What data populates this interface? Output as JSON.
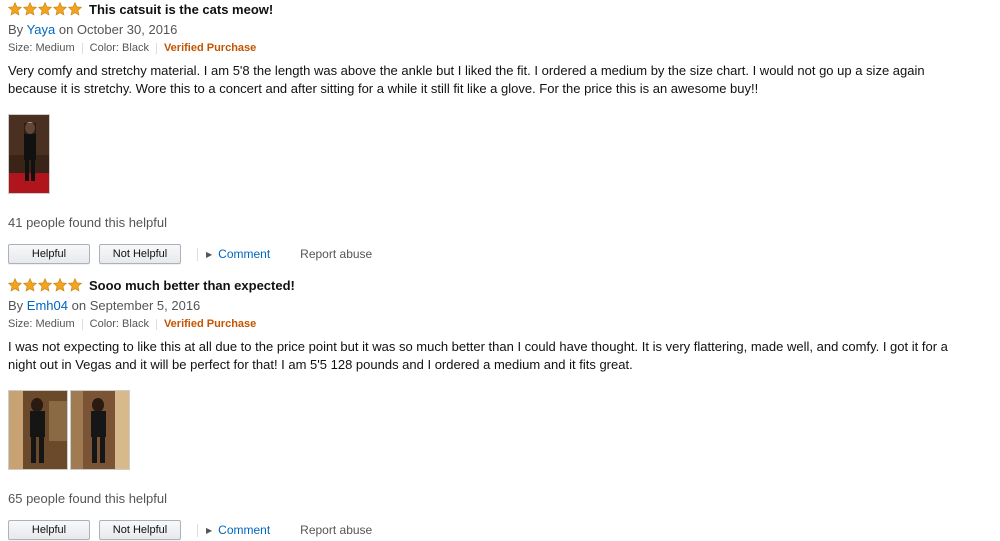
{
  "colors": {
    "star_fill": "#f4a41c",
    "star_stroke": "#c88719",
    "link_blue": "#0066c0",
    "verified_orange": "#c45500"
  },
  "reviews": [
    {
      "rating": 5,
      "title": "This catsuit is the cats meow!",
      "by_prefix": "By",
      "author": "Yaya",
      "date": "on October 30, 2016",
      "size": "Size: Medium",
      "color": "Color: Black",
      "verified": "Verified Purchase",
      "body": "Very comfy and stretchy material. I am 5'8 the length was above the ankle but I liked the fit. I ordered a medium by the size chart. I would not go up a size again because it is stretchy. Wore this to a concert and after sitting for a while it still fit like a glove. For the price this is an awesome buy!!",
      "image_count": 1,
      "helpful_count": "41 people found this helpful",
      "helpful_label": "Helpful",
      "not_helpful_label": "Not Helpful",
      "comment_label": "Comment",
      "report_label": "Report abuse"
    },
    {
      "rating": 5,
      "title": "Sooo much better than expected!",
      "by_prefix": "By",
      "author": "Emh04",
      "date": "on September 5, 2016",
      "size": "Size: Medium",
      "color": "Color: Black",
      "verified": "Verified Purchase",
      "body": "I was not expecting to like this at all due to the price point but it was so much better than I could have thought. It is very flattering, made well, and comfy. I got it for a night out in Vegas and it will be perfect for that! I am 5'5 128 pounds and I ordered a medium and it fits great.",
      "image_count": 2,
      "helpful_count": "65 people found this helpful",
      "helpful_label": "Helpful",
      "not_helpful_label": "Not Helpful",
      "comment_label": "Comment",
      "report_label": "Report abuse"
    }
  ]
}
